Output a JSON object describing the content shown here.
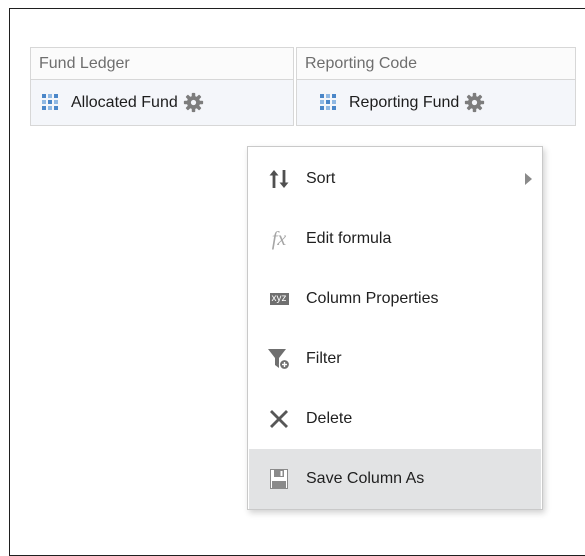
{
  "table": {
    "columns": [
      {
        "header": "Fund Ledger",
        "cell_label": "Allocated Fund"
      },
      {
        "header": "Reporting Code",
        "cell_label": "Reporting Fund"
      }
    ]
  },
  "icons": {
    "column_type": "grid-icon",
    "column_options": "gear-icon"
  },
  "context_menu": {
    "items": [
      {
        "label": "Sort",
        "icon": "sort-icon",
        "has_submenu": true
      },
      {
        "label": "Edit formula",
        "icon": "fx-icon",
        "glyph": "fx"
      },
      {
        "label": "Column Properties",
        "icon": "xyz-icon",
        "glyph": "xyz"
      },
      {
        "label": "Filter",
        "icon": "filter-icon"
      },
      {
        "label": "Delete",
        "icon": "delete-icon"
      },
      {
        "label": "Save Column As",
        "icon": "save-icon",
        "selected": true
      }
    ]
  },
  "colors": {
    "accent_blue": "#4a86c8",
    "icon_gray": "#808080",
    "selected_bg": "#e2e3e4"
  }
}
